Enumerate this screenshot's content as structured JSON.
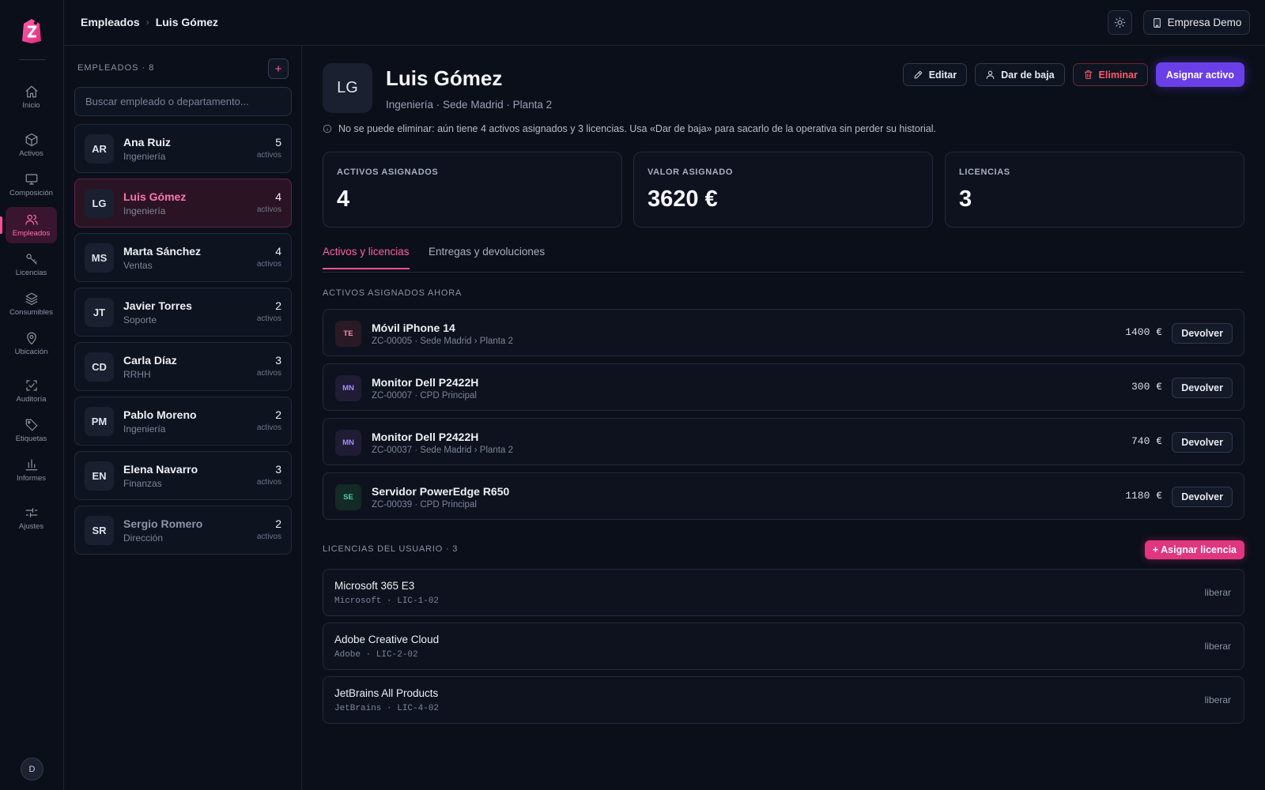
{
  "app": {
    "logo_letter": "Z",
    "brand_color": "#ff4f9a",
    "user_initial": "D"
  },
  "nav": [
    {
      "label": "Inicio",
      "icon": "home-icon"
    },
    {
      "label": "Activos",
      "icon": "box-icon"
    },
    {
      "label": "Composición",
      "icon": "monitor-icon"
    },
    {
      "label": "Empleados",
      "icon": "users-icon",
      "active": true
    },
    {
      "label": "Licencias",
      "icon": "key-icon"
    },
    {
      "label": "Consumibles",
      "icon": "layers-icon"
    },
    {
      "label": "Ubicación",
      "icon": "map-pin-icon"
    },
    {
      "label": "Auditoría",
      "icon": "scan-icon"
    },
    {
      "label": "Etiquetas",
      "icon": "tag-icon"
    },
    {
      "label": "Informes",
      "icon": "bar-chart-icon"
    },
    {
      "label": "Ajustes",
      "icon": "sliders-icon"
    }
  ],
  "header": {
    "breadcrumb": [
      "Empleados",
      "Luis Gómez"
    ],
    "company": "Empresa Demo"
  },
  "employees_panel": {
    "title": "EMPLEADOS · 8",
    "add_label": "+",
    "search_placeholder": "Buscar empleado o departamento...",
    "count_suffix": "activos",
    "items": [
      {
        "initials": "AR",
        "name": "Ana Ruiz",
        "dept": "Ingeniería",
        "count": "5"
      },
      {
        "initials": "LG",
        "name": "Luis Gómez",
        "dept": "Ingeniería",
        "count": "4",
        "selected": true
      },
      {
        "initials": "MS",
        "name": "Marta Sánchez",
        "dept": "Ventas",
        "count": "4"
      },
      {
        "initials": "JT",
        "name": "Javier Torres",
        "dept": "Soporte",
        "count": "2"
      },
      {
        "initials": "CD",
        "name": "Carla Díaz",
        "dept": "RRHH",
        "count": "3"
      },
      {
        "initials": "PM",
        "name": "Pablo Moreno",
        "dept": "Ingeniería",
        "count": "2"
      },
      {
        "initials": "EN",
        "name": "Elena Navarro",
        "dept": "Finanzas",
        "count": "3"
      },
      {
        "initials": "SR",
        "name": "Sergio Romero",
        "dept": "Dirección",
        "count": "2",
        "inactive": true
      }
    ]
  },
  "profile": {
    "initials": "LG",
    "name": "Luis Gómez",
    "subtitle": "Ingeniería · Sede Madrid · Planta 2",
    "actions": {
      "edit": "Editar",
      "deactivate": "Dar de baja",
      "delete": "Eliminar",
      "assign": "Asignar activo"
    },
    "notice": "No se puede eliminar: aún tiene 4 activos asignados y 3 licencias. Usa «Dar de baja» para sacarlo de la operativa sin perder su historial."
  },
  "stats": [
    {
      "label": "ACTIVOS ASIGNADOS",
      "value": "4"
    },
    {
      "label": "VALOR ASIGNADO",
      "value": "3620 €"
    },
    {
      "label": "LICENCIAS",
      "value": "3"
    }
  ],
  "tabs": [
    "Activos y licencias",
    "Entregas y devoluciones"
  ],
  "assets_section": {
    "title": "ACTIVOS ASIGNADOS AHORA",
    "return_label": "Devolver",
    "items": [
      {
        "tag": "TE",
        "kind": "te",
        "name": "Móvil iPhone 14",
        "meta": "ZC-00005 · Sede Madrid › Planta 2",
        "price": "1400 €"
      },
      {
        "tag": "MN",
        "kind": "mn",
        "name": "Monitor Dell P2422H",
        "meta": "ZC-00007 · CPD Principal",
        "price": "300 €"
      },
      {
        "tag": "MN",
        "kind": "mn",
        "name": "Monitor Dell P2422H",
        "meta": "ZC-00037 · Sede Madrid › Planta 2",
        "price": "740 €"
      },
      {
        "tag": "SE",
        "kind": "se",
        "name": "Servidor PowerEdge R650",
        "meta": "ZC-00039 · CPD Principal",
        "price": "1180 €"
      }
    ]
  },
  "licenses_section": {
    "title": "LICENCIAS DEL USUARIO · 3",
    "assign_label": "+ Asignar licencia",
    "release_label": "liberar",
    "items": [
      {
        "name": "Microsoft 365 E3",
        "meta": "Microsoft · LIC-1-02"
      },
      {
        "name": "Adobe Creative Cloud",
        "meta": "Adobe · LIC-2-02"
      },
      {
        "name": "JetBrains All Products",
        "meta": "JetBrains · LIC-4-02"
      }
    ]
  }
}
